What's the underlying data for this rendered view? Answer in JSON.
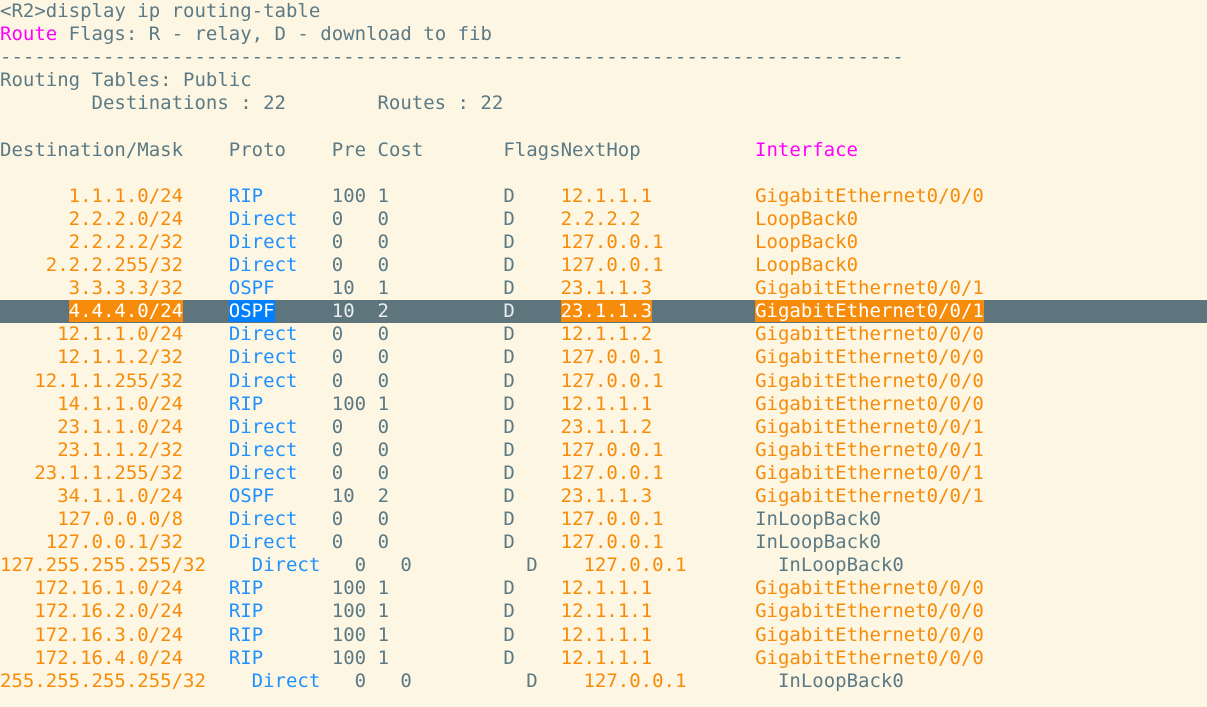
{
  "terminal": {
    "colors": {
      "background": "#fdf6e3",
      "default_text": "#5b7a85",
      "orange": "#f78c0a",
      "blue": "#1e90ff",
      "magenta": "#ff00ff",
      "selection_background": "#5f757e",
      "selection_text": "#ffffff"
    },
    "prompt": "<R2>",
    "command": "display ip routing-table",
    "command_line": "<R2>display ip routing-table",
    "route_flags_keyword": "Route",
    "route_flags_rest": " Flags: R - relay, D - download to fib",
    "separator": "-------------------------------------------------------------------------------",
    "routing_tables_label": "Routing Tables: Public",
    "summary": {
      "destinations_label": "Destinations : ",
      "destinations_value": "22",
      "routes_label": "Routes : ",
      "routes_value": "22",
      "line": "        Destinations : 22        Routes : 22"
    },
    "columns": {
      "destination": "Destination/Mask",
      "proto": "Proto",
      "pre": "Pre",
      "cost": "Cost",
      "flags": "Flags",
      "nexthop": "NextHop",
      "interface": "Interface"
    },
    "selected_row_index": 5,
    "routes": [
      {
        "destination": "1.1.1.0/24",
        "proto": "RIP",
        "pre": "100",
        "cost": "1",
        "flags": "D",
        "nexthop": "12.1.1.1",
        "interface": "GigabitEthernet0/0/0",
        "interface_color": "orange"
      },
      {
        "destination": "2.2.2.0/24",
        "proto": "Direct",
        "pre": "0",
        "cost": "0",
        "flags": "D",
        "nexthop": "2.2.2.2",
        "interface": "LoopBack0",
        "interface_color": "orange"
      },
      {
        "destination": "2.2.2.2/32",
        "proto": "Direct",
        "pre": "0",
        "cost": "0",
        "flags": "D",
        "nexthop": "127.0.0.1",
        "interface": "LoopBack0",
        "interface_color": "orange"
      },
      {
        "destination": "2.2.2.255/32",
        "proto": "Direct",
        "pre": "0",
        "cost": "0",
        "flags": "D",
        "nexthop": "127.0.0.1",
        "interface": "LoopBack0",
        "interface_color": "orange"
      },
      {
        "destination": "3.3.3.3/32",
        "proto": "OSPF",
        "pre": "10",
        "cost": "1",
        "flags": "D",
        "nexthop": "23.1.1.3",
        "interface": "GigabitEthernet0/0/1",
        "interface_color": "orange"
      },
      {
        "destination": "4.4.4.0/24",
        "proto": "OSPF",
        "pre": "10",
        "cost": "2",
        "flags": "D",
        "nexthop": "23.1.1.3",
        "interface": "GigabitEthernet0/0/1",
        "interface_color": "orange"
      },
      {
        "destination": "12.1.1.0/24",
        "proto": "Direct",
        "pre": "0",
        "cost": "0",
        "flags": "D",
        "nexthop": "12.1.1.2",
        "interface": "GigabitEthernet0/0/0",
        "interface_color": "orange"
      },
      {
        "destination": "12.1.1.2/32",
        "proto": "Direct",
        "pre": "0",
        "cost": "0",
        "flags": "D",
        "nexthop": "127.0.0.1",
        "interface": "GigabitEthernet0/0/0",
        "interface_color": "orange"
      },
      {
        "destination": "12.1.1.255/32",
        "proto": "Direct",
        "pre": "0",
        "cost": "0",
        "flags": "D",
        "nexthop": "127.0.0.1",
        "interface": "GigabitEthernet0/0/0",
        "interface_color": "orange"
      },
      {
        "destination": "14.1.1.0/24",
        "proto": "RIP",
        "pre": "100",
        "cost": "1",
        "flags": "D",
        "nexthop": "12.1.1.1",
        "interface": "GigabitEthernet0/0/0",
        "interface_color": "orange"
      },
      {
        "destination": "23.1.1.0/24",
        "proto": "Direct",
        "pre": "0",
        "cost": "0",
        "flags": "D",
        "nexthop": "23.1.1.2",
        "interface": "GigabitEthernet0/0/1",
        "interface_color": "orange"
      },
      {
        "destination": "23.1.1.2/32",
        "proto": "Direct",
        "pre": "0",
        "cost": "0",
        "flags": "D",
        "nexthop": "127.0.0.1",
        "interface": "GigabitEthernet0/0/1",
        "interface_color": "orange"
      },
      {
        "destination": "23.1.1.255/32",
        "proto": "Direct",
        "pre": "0",
        "cost": "0",
        "flags": "D",
        "nexthop": "127.0.0.1",
        "interface": "GigabitEthernet0/0/1",
        "interface_color": "orange"
      },
      {
        "destination": "34.1.1.0/24",
        "proto": "OSPF",
        "pre": "10",
        "cost": "2",
        "flags": "D",
        "nexthop": "23.1.1.3",
        "interface": "GigabitEthernet0/0/1",
        "interface_color": "orange"
      },
      {
        "destination": "127.0.0.0/8",
        "proto": "Direct",
        "pre": "0",
        "cost": "0",
        "flags": "D",
        "nexthop": "127.0.0.1",
        "interface": "InLoopBack0",
        "interface_color": "gray"
      },
      {
        "destination": "127.0.0.1/32",
        "proto": "Direct",
        "pre": "0",
        "cost": "0",
        "flags": "D",
        "nexthop": "127.0.0.1",
        "interface": "InLoopBack0",
        "interface_color": "gray"
      },
      {
        "destination": "127.255.255.255/32",
        "proto": "Direct",
        "pre": "0",
        "cost": "0",
        "flags": "D",
        "nexthop": "127.0.0.1",
        "interface": "InLoopBack0",
        "interface_color": "gray"
      },
      {
        "destination": "172.16.1.0/24",
        "proto": "RIP",
        "pre": "100",
        "cost": "1",
        "flags": "D",
        "nexthop": "12.1.1.1",
        "interface": "GigabitEthernet0/0/0",
        "interface_color": "orange"
      },
      {
        "destination": "172.16.2.0/24",
        "proto": "RIP",
        "pre": "100",
        "cost": "1",
        "flags": "D",
        "nexthop": "12.1.1.1",
        "interface": "GigabitEthernet0/0/0",
        "interface_color": "orange"
      },
      {
        "destination": "172.16.3.0/24",
        "proto": "RIP",
        "pre": "100",
        "cost": "1",
        "flags": "D",
        "nexthop": "12.1.1.1",
        "interface": "GigabitEthernet0/0/0",
        "interface_color": "orange"
      },
      {
        "destination": "172.16.4.0/24",
        "proto": "RIP",
        "pre": "100",
        "cost": "1",
        "flags": "D",
        "nexthop": "12.1.1.1",
        "interface": "GigabitEthernet0/0/0",
        "interface_color": "orange"
      },
      {
        "destination": "255.255.255.255/32",
        "proto": "Direct",
        "pre": "0",
        "cost": "0",
        "flags": "D",
        "nexthop": "127.0.0.1",
        "interface": "InLoopBack0",
        "interface_color": "gray"
      }
    ]
  }
}
